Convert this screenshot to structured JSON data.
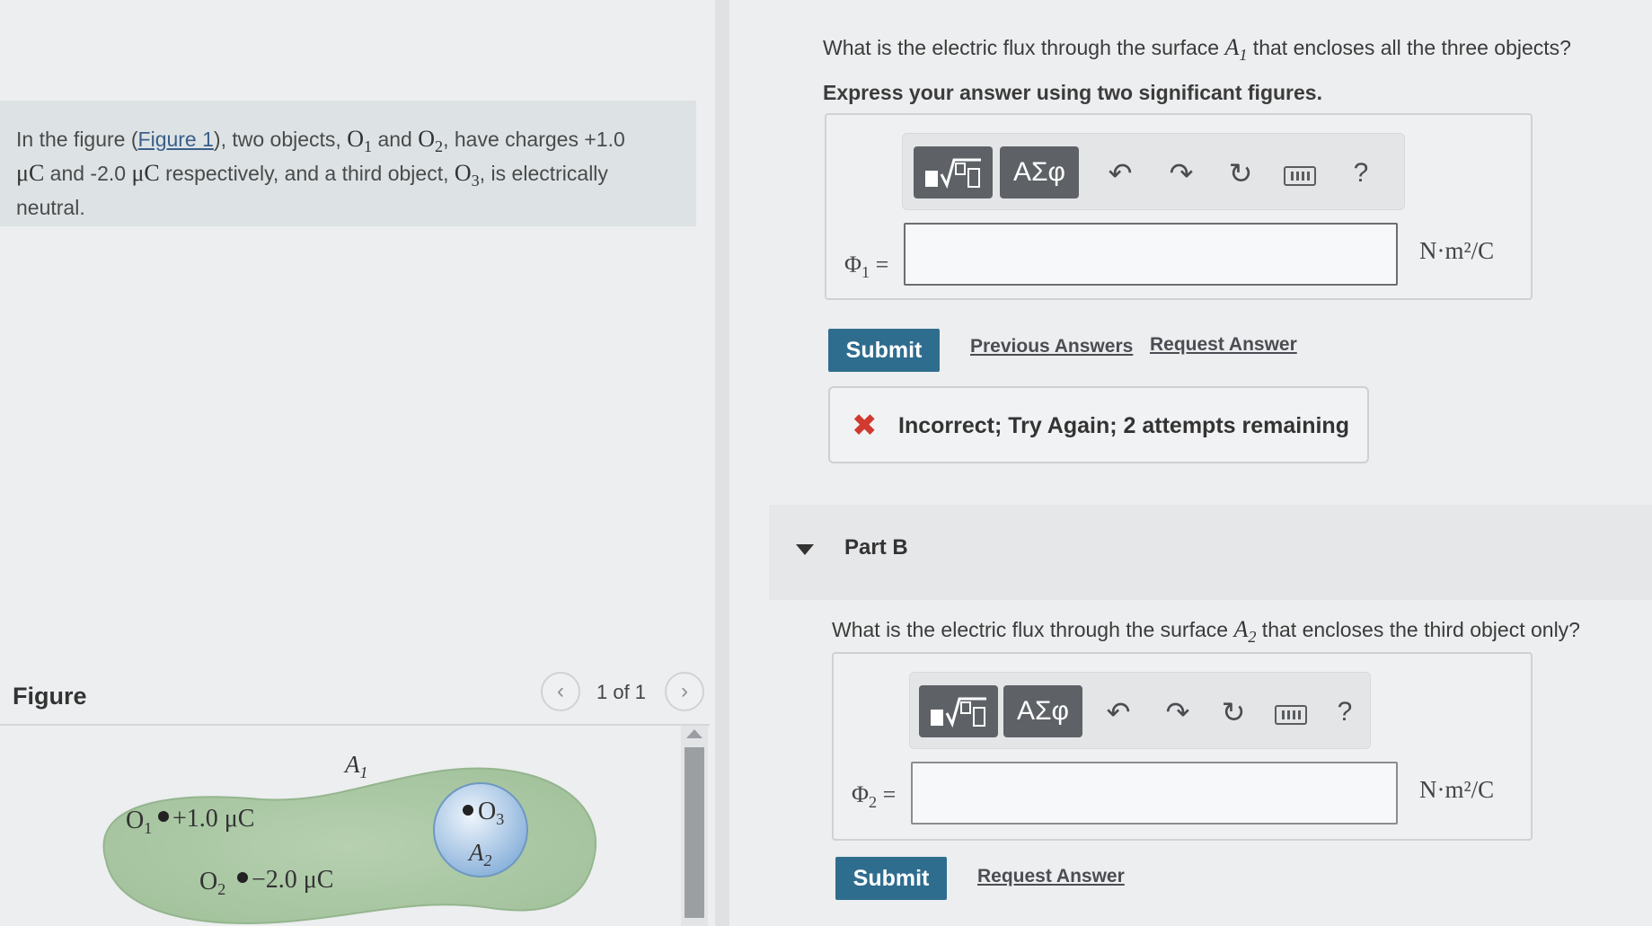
{
  "problem": {
    "text_intro": "In the figure (",
    "figure_link": "Figure 1",
    "text_mid": "), two objects, ",
    "o1": "O",
    "o1_sub": "1",
    "and": " and ",
    "o2": "O",
    "o2_sub": "2",
    "text_charges": ", have charges +1.0",
    "mu_c1": "μC",
    "text_and2": " and -2.0 ",
    "mu_c2": "μC",
    "text_resp": " respectively, and a third object, ",
    "o3": "O",
    "o3_sub": "3",
    "text_end": ", is electrically",
    "text_neutral": "neutral."
  },
  "figure": {
    "title": "Figure",
    "counter": "1 of 1",
    "prev_icon": "chevron-left-icon",
    "next_icon": "chevron-right-icon",
    "labels": {
      "a1": "A",
      "a1_sub": "1",
      "o1_text": "O",
      "o1_sub": "1",
      "o1_charge": "+1.0 μC",
      "o2_text": "O",
      "o2_sub": "2",
      "o2_charge": "−2.0 μC",
      "o3_text": "O",
      "o3_sub": "3",
      "a2": "A",
      "a2_sub": "2"
    },
    "colors": {
      "outer": "#a9c6a3",
      "inner_light": "#e8f1fa",
      "inner_dark": "#8fb6dd"
    }
  },
  "part_a": {
    "question_pre": "What is the electric flux through the surface ",
    "question_sym": "A",
    "question_sub": "1",
    "question_post": " that encloses all the three objects?",
    "instruction": "Express your answer using two significant figures.",
    "toolbar": {
      "template_btn": "template-sqrt-icon",
      "greek_btn": "ΑΣφ",
      "undo": "↶",
      "redo": "↷",
      "reset": "↻",
      "help": "?"
    },
    "phi_label": "Φ",
    "phi_sub": "1",
    "phi_eq": " =",
    "input_value": "",
    "unit": "N·m²/C",
    "submit": "Submit",
    "previous_answers": "Previous Answers",
    "request_answer": "Request Answer",
    "feedback": {
      "icon": "✖",
      "text": "Incorrect; Try Again; 2 attempts remaining"
    }
  },
  "part_b": {
    "title": "Part B",
    "question_pre": "What is the electric flux through the surface ",
    "question_sym": "A",
    "question_sub": "2",
    "question_post": " that encloses the third object only?",
    "toolbar": {
      "template_btn": "template-sqrt-icon",
      "greek_btn": "ΑΣφ",
      "undo": "↶",
      "redo": "↷",
      "reset": "↻",
      "help": "?"
    },
    "phi_label": "Φ",
    "phi_sub": "2",
    "phi_eq": " =",
    "input_value": "",
    "unit": "N·m²/C",
    "submit": "Submit",
    "request_answer": "Request Answer"
  }
}
